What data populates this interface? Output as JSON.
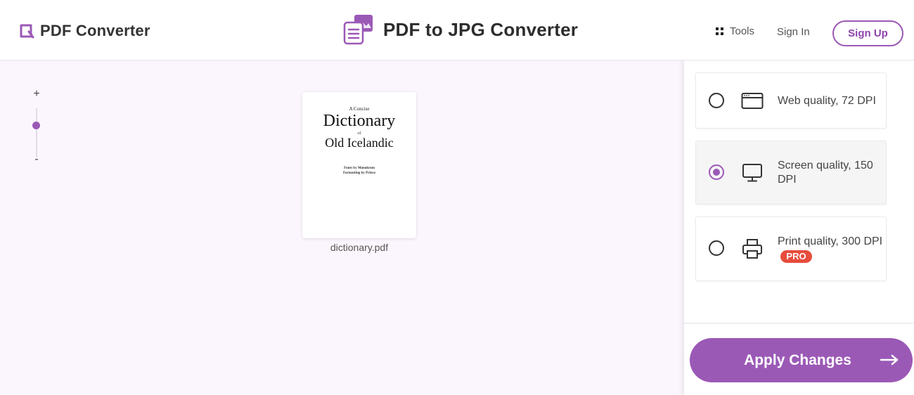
{
  "header": {
    "brand": "PDF Converter",
    "title": "PDF to JPG Converter",
    "tools_label": "Tools",
    "signin_label": "Sign In",
    "signup_label": "Sign Up"
  },
  "zoom": {
    "plus": "+",
    "minus": "-",
    "level": 0.75
  },
  "document": {
    "pre_title": "A Concise",
    "title_line1": "Dictionary",
    "of": "of",
    "title_line2": "Old Icelandic",
    "credit_line1": "Fonts by Monokrom",
    "credit_line2": "Formatting by Prince",
    "filename": "dictionary.pdf"
  },
  "quality_options": [
    {
      "label": "Web quality, 72 DPI",
      "icon": "browser-window-icon",
      "selected": false
    },
    {
      "label": "Screen quality, 150 DPI",
      "icon": "monitor-icon",
      "selected": true
    },
    {
      "label": "Print quality, 300 DPI",
      "icon": "printer-icon",
      "selected": false,
      "badge": "PRO"
    }
  ],
  "apply_label": "Apply Changes",
  "colors": {
    "accent": "#9b59b6",
    "badge": "#e74c3c",
    "background": "#fbf6fd"
  }
}
